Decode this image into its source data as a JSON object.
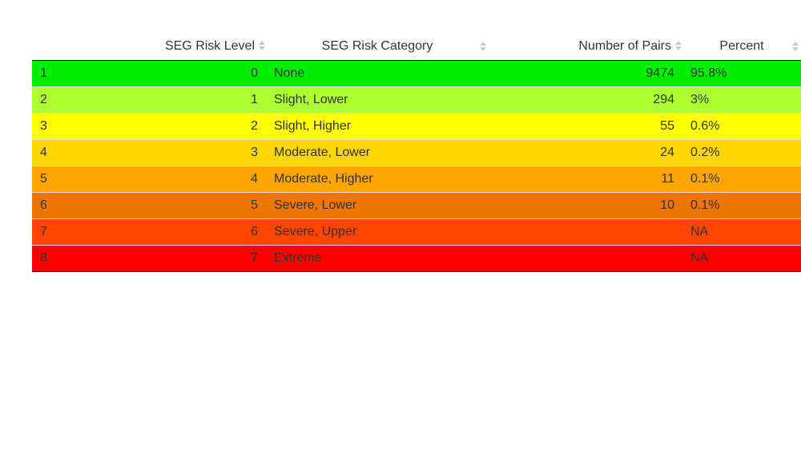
{
  "table": {
    "headers": {
      "level": "SEG Risk Level",
      "category": "SEG Risk Category",
      "pairs": "Number of Pairs",
      "percent": "Percent"
    },
    "rows": [
      {
        "index": "1",
        "level": "0",
        "category": "None",
        "pairs": "9474",
        "percent": "95.8%",
        "color": "#00ee00"
      },
      {
        "index": "2",
        "level": "1",
        "category": "Slight, Lower",
        "pairs": "294",
        "percent": "3%",
        "color": "#adff2f"
      },
      {
        "index": "3",
        "level": "2",
        "category": "Slight, Higher",
        "pairs": "55",
        "percent": "0.6%",
        "color": "#ffff00"
      },
      {
        "index": "4",
        "level": "3",
        "category": "Moderate, Lower",
        "pairs": "24",
        "percent": "0.2%",
        "color": "#ffd700"
      },
      {
        "index": "5",
        "level": "4",
        "category": "Moderate, Higher",
        "pairs": "11",
        "percent": "0.1%",
        "color": "#ffa500"
      },
      {
        "index": "6",
        "level": "5",
        "category": "Severe, Lower",
        "pairs": "10",
        "percent": "0.1%",
        "color": "#ee7600"
      },
      {
        "index": "7",
        "level": "6",
        "category": "Severe, Upper",
        "pairs": "",
        "percent": "NA",
        "color": "#ff4500"
      },
      {
        "index": "8",
        "level": "7",
        "category": "Extreme",
        "pairs": "",
        "percent": "NA",
        "color": "#ff0000"
      }
    ]
  }
}
